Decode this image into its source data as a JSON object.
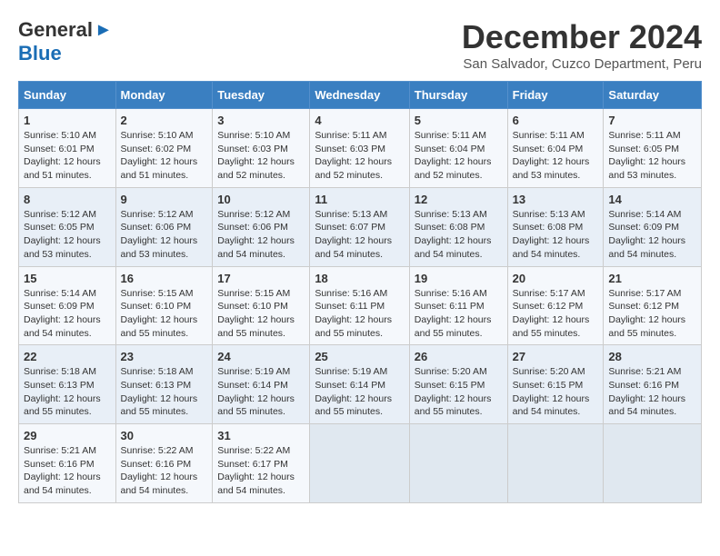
{
  "header": {
    "logo_general": "General",
    "logo_blue": "Blue",
    "title": "December 2024",
    "subtitle": "San Salvador, Cuzco Department, Peru"
  },
  "weekdays": [
    "Sunday",
    "Monday",
    "Tuesday",
    "Wednesday",
    "Thursday",
    "Friday",
    "Saturday"
  ],
  "weeks": [
    [
      {
        "day": "1",
        "info": "Sunrise: 5:10 AM\nSunset: 6:01 PM\nDaylight: 12 hours\nand 51 minutes."
      },
      {
        "day": "2",
        "info": "Sunrise: 5:10 AM\nSunset: 6:02 PM\nDaylight: 12 hours\nand 51 minutes."
      },
      {
        "day": "3",
        "info": "Sunrise: 5:10 AM\nSunset: 6:03 PM\nDaylight: 12 hours\nand 52 minutes."
      },
      {
        "day": "4",
        "info": "Sunrise: 5:11 AM\nSunset: 6:03 PM\nDaylight: 12 hours\nand 52 minutes."
      },
      {
        "day": "5",
        "info": "Sunrise: 5:11 AM\nSunset: 6:04 PM\nDaylight: 12 hours\nand 52 minutes."
      },
      {
        "day": "6",
        "info": "Sunrise: 5:11 AM\nSunset: 6:04 PM\nDaylight: 12 hours\nand 53 minutes."
      },
      {
        "day": "7",
        "info": "Sunrise: 5:11 AM\nSunset: 6:05 PM\nDaylight: 12 hours\nand 53 minutes."
      }
    ],
    [
      {
        "day": "8",
        "info": "Sunrise: 5:12 AM\nSunset: 6:05 PM\nDaylight: 12 hours\nand 53 minutes."
      },
      {
        "day": "9",
        "info": "Sunrise: 5:12 AM\nSunset: 6:06 PM\nDaylight: 12 hours\nand 53 minutes."
      },
      {
        "day": "10",
        "info": "Sunrise: 5:12 AM\nSunset: 6:06 PM\nDaylight: 12 hours\nand 54 minutes."
      },
      {
        "day": "11",
        "info": "Sunrise: 5:13 AM\nSunset: 6:07 PM\nDaylight: 12 hours\nand 54 minutes."
      },
      {
        "day": "12",
        "info": "Sunrise: 5:13 AM\nSunset: 6:08 PM\nDaylight: 12 hours\nand 54 minutes."
      },
      {
        "day": "13",
        "info": "Sunrise: 5:13 AM\nSunset: 6:08 PM\nDaylight: 12 hours\nand 54 minutes."
      },
      {
        "day": "14",
        "info": "Sunrise: 5:14 AM\nSunset: 6:09 PM\nDaylight: 12 hours\nand 54 minutes."
      }
    ],
    [
      {
        "day": "15",
        "info": "Sunrise: 5:14 AM\nSunset: 6:09 PM\nDaylight: 12 hours\nand 54 minutes."
      },
      {
        "day": "16",
        "info": "Sunrise: 5:15 AM\nSunset: 6:10 PM\nDaylight: 12 hours\nand 55 minutes."
      },
      {
        "day": "17",
        "info": "Sunrise: 5:15 AM\nSunset: 6:10 PM\nDaylight: 12 hours\nand 55 minutes."
      },
      {
        "day": "18",
        "info": "Sunrise: 5:16 AM\nSunset: 6:11 PM\nDaylight: 12 hours\nand 55 minutes."
      },
      {
        "day": "19",
        "info": "Sunrise: 5:16 AM\nSunset: 6:11 PM\nDaylight: 12 hours\nand 55 minutes."
      },
      {
        "day": "20",
        "info": "Sunrise: 5:17 AM\nSunset: 6:12 PM\nDaylight: 12 hours\nand 55 minutes."
      },
      {
        "day": "21",
        "info": "Sunrise: 5:17 AM\nSunset: 6:12 PM\nDaylight: 12 hours\nand 55 minutes."
      }
    ],
    [
      {
        "day": "22",
        "info": "Sunrise: 5:18 AM\nSunset: 6:13 PM\nDaylight: 12 hours\nand 55 minutes."
      },
      {
        "day": "23",
        "info": "Sunrise: 5:18 AM\nSunset: 6:13 PM\nDaylight: 12 hours\nand 55 minutes."
      },
      {
        "day": "24",
        "info": "Sunrise: 5:19 AM\nSunset: 6:14 PM\nDaylight: 12 hours\nand 55 minutes."
      },
      {
        "day": "25",
        "info": "Sunrise: 5:19 AM\nSunset: 6:14 PM\nDaylight: 12 hours\nand 55 minutes."
      },
      {
        "day": "26",
        "info": "Sunrise: 5:20 AM\nSunset: 6:15 PM\nDaylight: 12 hours\nand 55 minutes."
      },
      {
        "day": "27",
        "info": "Sunrise: 5:20 AM\nSunset: 6:15 PM\nDaylight: 12 hours\nand 54 minutes."
      },
      {
        "day": "28",
        "info": "Sunrise: 5:21 AM\nSunset: 6:16 PM\nDaylight: 12 hours\nand 54 minutes."
      }
    ],
    [
      {
        "day": "29",
        "info": "Sunrise: 5:21 AM\nSunset: 6:16 PM\nDaylight: 12 hours\nand 54 minutes."
      },
      {
        "day": "30",
        "info": "Sunrise: 5:22 AM\nSunset: 6:16 PM\nDaylight: 12 hours\nand 54 minutes."
      },
      {
        "day": "31",
        "info": "Sunrise: 5:22 AM\nSunset: 6:17 PM\nDaylight: 12 hours\nand 54 minutes."
      },
      null,
      null,
      null,
      null
    ]
  ]
}
